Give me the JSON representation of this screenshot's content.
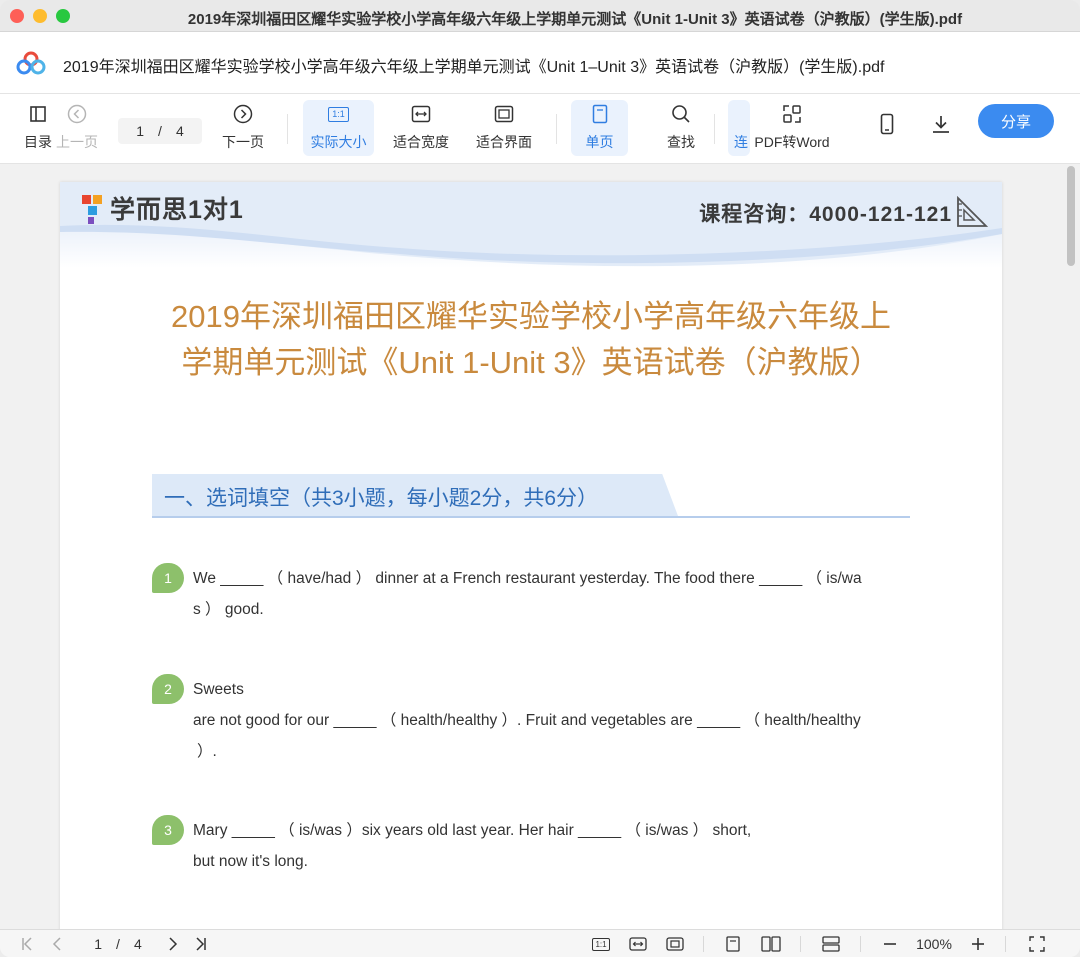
{
  "window": {
    "title": "2019年深圳福田区耀华实验学校小学高年级六年级上学期单元测试《Unit 1-Unit 3》英语试卷（沪教版）(学生版).pdf"
  },
  "doc_header": {
    "title": "2019年深圳福田区耀华实验学校小学高年级六年级上学期单元测试《Unit 1–Unit 3》英语试卷（沪教版）(学生版).pdf",
    "logo_icon": "cloud-logo-icon"
  },
  "toolbar": {
    "toc_label": "目录",
    "prev_label": "上一页",
    "page_current": "1",
    "page_sep": "/",
    "page_total": "4",
    "next_label": "下一页",
    "actual_size_label": "实际大小",
    "actual_size_icon_text": "1:1",
    "fit_width_label": "适合宽度",
    "fit_page_label": "适合界面",
    "single_page_label": "单页",
    "find_label": "查找",
    "continuous_label": "连",
    "pdf_to_word_label": "PDF转Word",
    "share_label": "分享",
    "accent": "#3b8bf0"
  },
  "page": {
    "brand": "学而思1对1",
    "consult": "课程咨询：4000-121-121",
    "exam_title": "2019年深圳福田区耀华实验学校小学高年级六年级上学期单元测试《Unit 1-Unit 3》英语试卷（沪教版）",
    "section1": "一、选词填空（共3小题，每小题2分，共6分）",
    "questions": [
      {
        "num": "1",
        "line1": "We _____ （ have/had ） dinner at a French restaurant yesterday. The food there _____ （ is/wa",
        "line2": "s ） good."
      },
      {
        "num": "2",
        "line1": "Sweets",
        "line2": "are not good for our _____ （ health/healthy ）. Fruit and vegetables are _____ （ health/healthy",
        "line3": "）."
      },
      {
        "num": "3",
        "line1": "Mary _____ （ is/was ）six years old last year. Her hair _____ （ is/was ） short,",
        "line2": "but now it's long."
      }
    ]
  },
  "statusbar": {
    "page_current": "1",
    "page_sep": "/",
    "page_total": "4",
    "actual_size_icon_text": "1:1",
    "zoom": "100%"
  }
}
